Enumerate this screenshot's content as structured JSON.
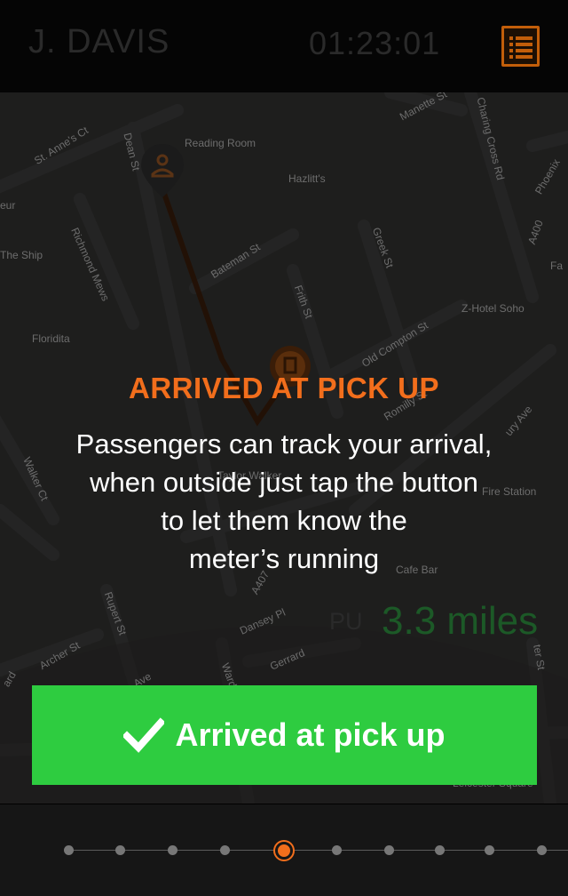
{
  "header": {
    "driver_name": "J. DAVIS",
    "timer": "01:23:01",
    "menu_icon": "list-icon",
    "accent_color": "#c25e0a"
  },
  "map": {
    "street_labels": [
      "St. Anne's Ct",
      "Reading Room",
      "Hazlitt's",
      "Richmond Mews",
      "Bateman St",
      "Greek St",
      "Frith St",
      "Old Compton St",
      "Z-Hotel Soho",
      "Manette St",
      "Charing Cross Rd",
      "A400",
      "Phoenix",
      "Floridita",
      "The Ship",
      "eur",
      "Fire Station",
      "Taylor Walker",
      "Cafe Bar",
      "A407",
      "Dansey Pl",
      "Rupert St",
      "Archer St",
      "Wardour St",
      "Gerrard",
      "Leicester Square",
      "Ave",
      "ard",
      "Fa",
      "ter St",
      "Walker Ct",
      "Dean St",
      "Romilly St",
      "ury Ave"
    ],
    "pickup_icon": "pickup-pin-icon",
    "destination_icon": "destination-pin-icon"
  },
  "overlay": {
    "title": "ARRIVED AT PICK UP",
    "line1": "Passengers can track your arrival,",
    "line2": "when outside just tap the button",
    "line3": "to let them know the",
    "line4": "meter’s running",
    "title_color": "#f26e1c"
  },
  "distance": {
    "label": "PU",
    "value": "3.3 miles"
  },
  "action": {
    "label": "Arrived at pick up",
    "icon": "check-icon",
    "color": "#2ecc40"
  },
  "stepper": {
    "total_steps": 10,
    "active_step": 5
  }
}
